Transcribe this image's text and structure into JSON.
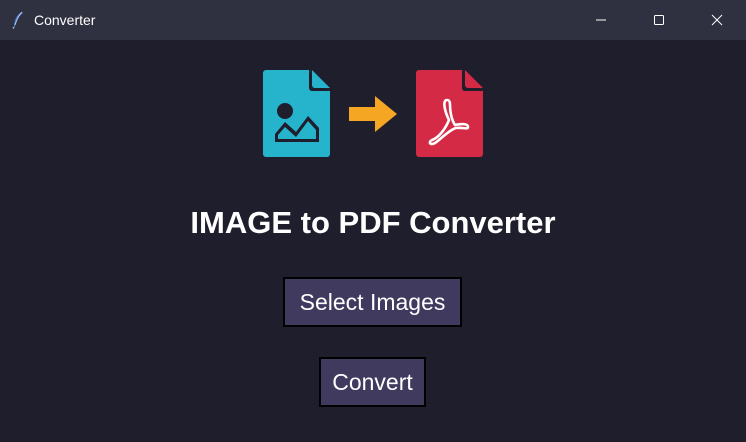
{
  "window": {
    "title": "Converter",
    "controls": [
      "minimize",
      "maximize",
      "close"
    ]
  },
  "logo": {
    "source_icon": "image-file-icon",
    "arrow_icon": "right-arrow-icon",
    "target_icon": "pdf-file-icon",
    "colors": {
      "image_file": "#26b3cc",
      "arrow": "#f5a623",
      "pdf_file": "#d42a45"
    }
  },
  "main": {
    "heading": "IMAGE to PDF Converter",
    "select_button_label": "Select Images",
    "convert_button_label": "Convert"
  },
  "theme": {
    "background": "#1e1e2c",
    "titlebar": "#2f3140",
    "button_bg": "#3f3a5e",
    "text": "#ffffff"
  }
}
